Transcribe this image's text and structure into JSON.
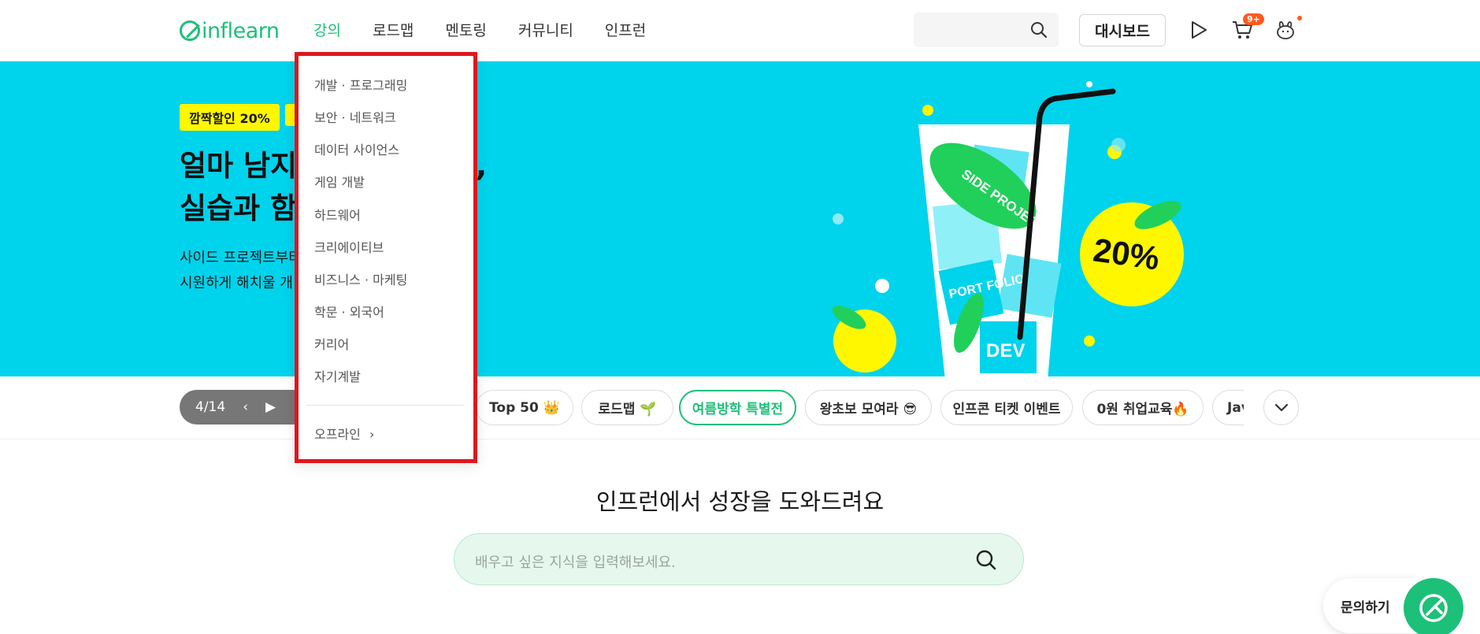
{
  "header": {
    "logo_text": "inflearn",
    "nav": [
      "강의",
      "로드맵",
      "멘토링",
      "커뮤니티",
      "인프런"
    ],
    "dashboard_label": "대시보드",
    "cart_badge": "9+"
  },
  "hero": {
    "tag": "깜짝할인 20%",
    "title_line1": "얼마 남지",
    "title_line1_tail": ",",
    "title_line2": "실습과 함",
    "sub_line1": "사이드 프로젝트부터",
    "sub_line2": "시원하게 해치울 개",
    "art_leaf_text": "SIDE PROJECT",
    "art_box_text": "PORT FOLIO",
    "art_dev_text": "DEV",
    "art_percent_text": "20%"
  },
  "pillbar": {
    "counter": "4/14",
    "pills": [
      "Top 50 👑",
      "로드맵 🌱",
      "여름방학 특별전",
      "왕초보 모여라 😎",
      "인프콘 티켓 이벤트",
      "0원 취업교육🔥",
      "Jav"
    ]
  },
  "main": {
    "title": "인프런에서 성장을 도와드려요",
    "search_placeholder": "배우고 싶은 지식을 입력해보세요."
  },
  "dropdown": {
    "items": [
      "개발 · 프로그래밍",
      "보안 · 네트워크",
      "데이터 사이언스",
      "게임 개발",
      "하드웨어",
      "크리에이티브",
      "비즈니스 · 마케팅",
      "학문 · 외국어",
      "커리어",
      "자기계발"
    ],
    "offline": "오프라인"
  },
  "inquiry": {
    "label": "문의하기"
  },
  "colors": {
    "brand_green": "#1dc078",
    "hero_bg": "#00d3ec",
    "highlight_yellow": "#fff700",
    "dropdown_border": "#e0161d"
  }
}
